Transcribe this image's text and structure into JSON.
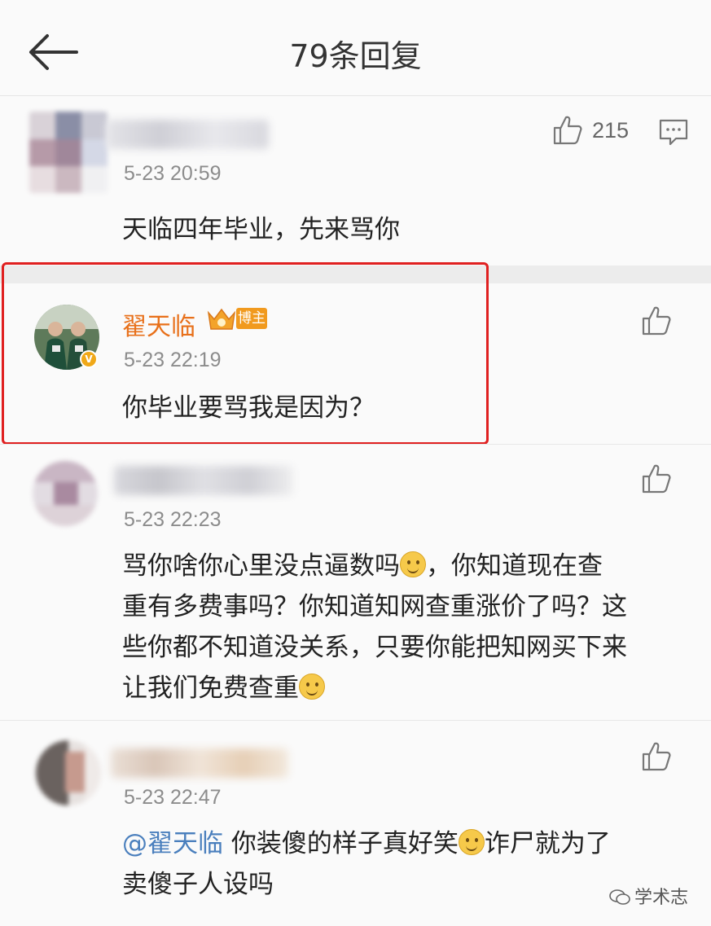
{
  "header": {
    "title": "79条回复"
  },
  "post": {
    "time": "5-23 20:59",
    "content": "天临四年毕业，先来骂你",
    "likes": "215"
  },
  "comments": [
    {
      "username": "翟天临",
      "badge": "博主",
      "time": "5-23 22:19",
      "content": "你毕业要骂我是因为？"
    },
    {
      "time": "5-23 22:23",
      "lines": [
        "骂你啥你心里没点逼数吗",
        "，你知道现在查",
        "重有多费事吗？你知道知网查重涨价了吗？这",
        "些你都不知道没关系，只要你能把知网买下来",
        "让我们免费查重"
      ]
    },
    {
      "time": "5-23 22:47",
      "mention": "@翟天临",
      "line1": " 你装傻的样子真好笑",
      "line1b": "诈尸就为了",
      "line2": "卖傻子人设吗"
    }
  ],
  "watermark": "学术志",
  "colors": {
    "username": "#e8701a",
    "mention": "#4a7fbd",
    "highlight": "#e02020"
  },
  "icons": [
    "back-arrow-icon",
    "thumbs-up-icon",
    "reply-comment-icon",
    "crown-icon",
    "verified-icon",
    "smile-emoji-icon",
    "wechat-icon"
  ]
}
